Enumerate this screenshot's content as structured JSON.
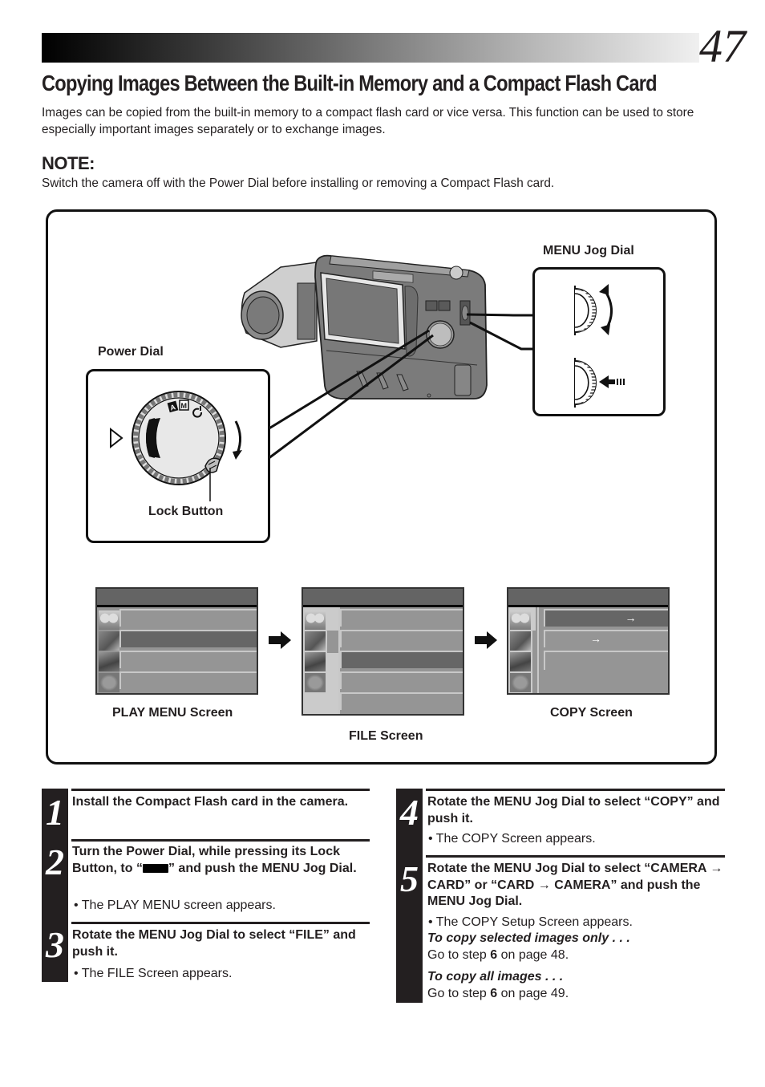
{
  "header": {
    "page_number": "47",
    "title": "Copying Images Between the Built-in Memory and a Compact Flash Card"
  },
  "intro": "Images can be copied from the built-in memory to a compact flash card or vice versa. This function can be used to store especially important images separately or to exchange images.",
  "note": {
    "heading": "NOTE:",
    "text": "Switch the camera off with the Power Dial before installing or removing a Compact Flash card."
  },
  "figure": {
    "labels": {
      "menu_jog_dial": "MENU Jog Dial",
      "power_dial": "Power Dial",
      "lock_button": "Lock Button",
      "play_menu_screen": "PLAY MENU Screen",
      "file_screen": "FILE Screen",
      "copy_screen": "COPY Screen"
    },
    "icons": {
      "jog_rotate": "rotate-arrows-icon",
      "jog_push": "push-arrow-icon",
      "flow_arrow": "right-arrow-icon",
      "copy_direction": "right-arrow-icon"
    },
    "power_dial_modes": [
      "A",
      "M",
      "power-off"
    ],
    "screens": {
      "play_menu": {
        "rows": 4,
        "selected_row": 2
      },
      "file": {
        "rows": 5,
        "selected_row": 3
      },
      "copy": {
        "rows": 3,
        "selected_row": 1,
        "arrow_glyph": "→"
      }
    }
  },
  "steps_left": [
    {
      "number": "1",
      "heading": "Install the Compact Flash card in the camera.",
      "bullets": []
    },
    {
      "number": "2",
      "heading_before": "Turn the Power Dial, while pressing its Lock Button, to “",
      "heading_icon": "play-mode-black-rectangle-icon",
      "heading_after": "” and push the MENU Jog Dial.",
      "bullets": [
        "The PLAY MENU screen appears."
      ]
    },
    {
      "number": "3",
      "heading": "Rotate the MENU Jog Dial to select “FILE” and push it.",
      "bullets": [
        "The FILE Screen appears."
      ]
    }
  ],
  "steps_right": [
    {
      "number": "4",
      "heading": "Rotate the MENU Jog Dial to select “COPY” and push it.",
      "bullets": [
        "The COPY Screen appears."
      ]
    },
    {
      "number": "5",
      "heading": "Rotate the MENU Jog Dial to select “CAMERA → CARD” or “CARD → CAMERA” and push the MENU Jog Dial.",
      "bullets": [
        "The COPY Setup Screen appears."
      ],
      "options": [
        {
          "label": "To copy selected images only . . .",
          "text_before": "Go to step ",
          "step": "6",
          "text_after": " on page 48."
        },
        {
          "label": "To copy all images . . .",
          "text_before": "Go to step ",
          "step": "6",
          "text_after": " on page 49."
        }
      ]
    }
  ]
}
